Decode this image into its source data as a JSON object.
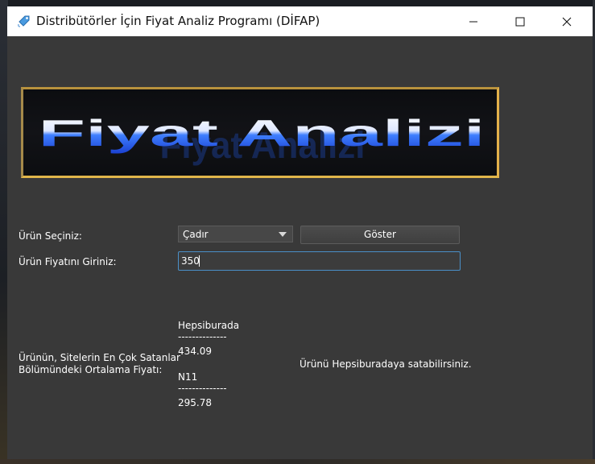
{
  "window": {
    "title": "Distribütörler İçin Fiyat Analiz Programı (DİFAP)",
    "icon": "tag-link-icon",
    "controls": [
      "minimize-icon",
      "maximize-icon",
      "close-icon"
    ]
  },
  "banner": {
    "text": "Fiyat Analizi"
  },
  "form": {
    "product_label": "Ürün Seçiniz:",
    "product_selected": "Çadır",
    "show_button": "Göster",
    "price_label": "Ürün Fiyatını Giriniz:",
    "price_value": "350"
  },
  "results": {
    "label_line1": "Ürünün, Sitelerin En Çok Satanlar",
    "label_line2": "Bölümündeki Ortalama Fiyatı:",
    "site1_name": "Hepsiburada",
    "site1_sep": "--------------",
    "site1_price": "434.09",
    "site2_name": "N11",
    "site2_sep": "--------------",
    "site2_price": "295.78",
    "recommendation": "Ürünü Hepsiburadaya satabilirsiniz."
  },
  "colors": {
    "window_bg": "#393939",
    "input_focus": "#4a90c8",
    "banner_border": "#c49a3a"
  }
}
